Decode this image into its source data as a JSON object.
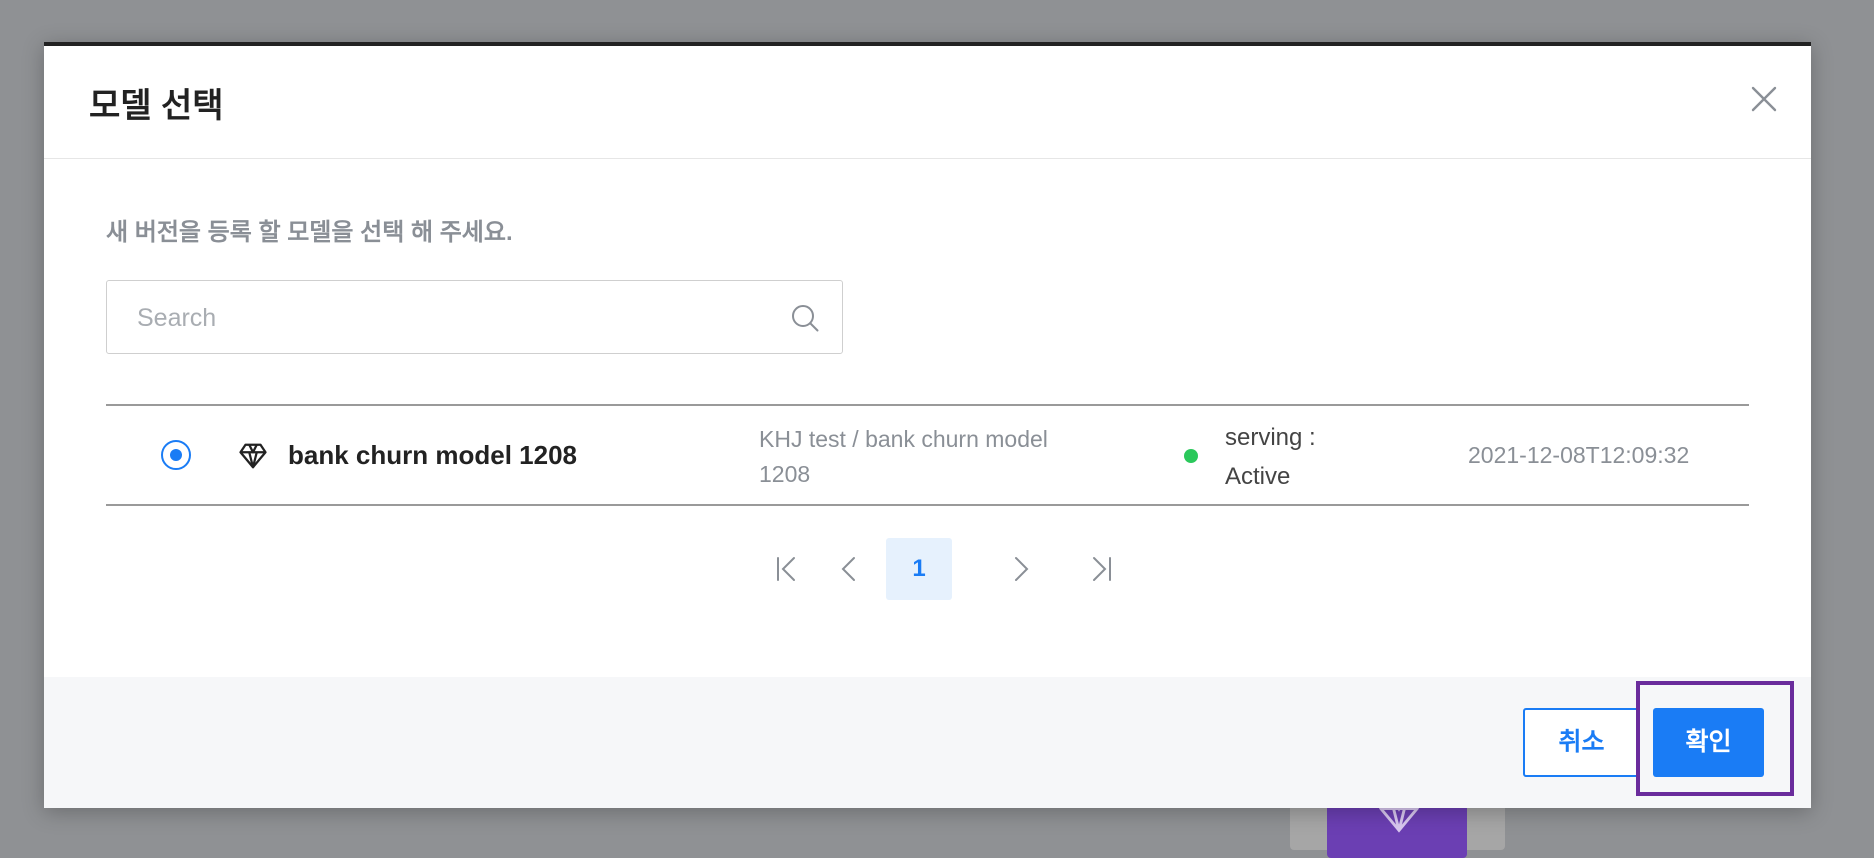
{
  "modal": {
    "title": "모델 선택",
    "instruction": "새 버전을 등록 할 모델을 선택 해 주세요.",
    "search": {
      "placeholder": "Search",
      "value": ""
    },
    "rows": [
      {
        "selected": true,
        "name": "bank churn model 1208",
        "path": "KHJ test / bank churn model 1208",
        "status": "serving : Active",
        "status_color": "#2bc85b",
        "date": "2021-12-08T12:09:32",
        "icon": "diamond-icon"
      }
    ],
    "pagination": {
      "current_page": "1"
    },
    "footer": {
      "cancel_label": "취소",
      "confirm_label": "확인"
    }
  },
  "colors": {
    "accent": "#1a7cf5",
    "highlight": "#6a2c9c",
    "overlay": "#8f9194"
  }
}
